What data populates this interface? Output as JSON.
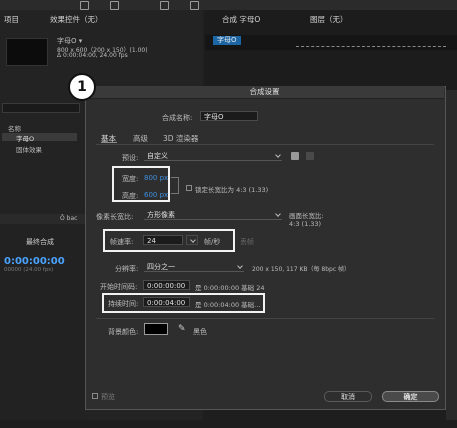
{
  "project_panel": {
    "tab_project": "项目",
    "tab_effects": "效果控件（无）",
    "item_name": "字母O ▾",
    "item_meta": [
      "800 x 600（200 x 150）(1.00)",
      "Δ 0:00:04:00, 24.00 fps"
    ],
    "column_header": "名称",
    "rows": [
      "字母O",
      "固体效果"
    ]
  },
  "comp_panel": {
    "tab_comp": "合成 字母O",
    "tab_layer": "图层（无）",
    "comp_chip": "字母O"
  },
  "timeline_panel": {
    "tab": "最终合成",
    "timecode": "0:00:00:00",
    "sub": "00000 (24.00 fps)",
    "search_chip": "Ô bac"
  },
  "dialog": {
    "title": "合成设置",
    "name_label": "合成名称:",
    "name_value": "字母O",
    "tabs": [
      "基本",
      "高级",
      "3D 渲染器"
    ],
    "preset_label": "预设:",
    "preset_value": "自定义",
    "width_label": "宽度:",
    "width_value": "800 px",
    "height_label": "高度:",
    "height_value": "600 px",
    "lock_aspect_label": "锁定长宽比为 4:3 (1.33)",
    "pixel_aspect_label": "像素长宽比:",
    "pixel_aspect_value": "方形像素",
    "frame_aspect_label": "画面长宽比:",
    "frame_aspect_value": "4:3 (1.33)",
    "frame_rate_label": "帧速率:",
    "frame_rate_value": "24",
    "frame_rate_unit": "帧/秒",
    "drop_frame": "丢帧",
    "resolution_label": "分辨率:",
    "resolution_value": "四分之一",
    "resolution_info": "200 x 150, 117 KB（每 8bpc 帧）",
    "start_tc_label": "开始时间码:",
    "start_tc_value": "0:00:00:00",
    "start_tc_info": "是 0:00:00:00 基础 24",
    "duration_label": "持续时间:",
    "duration_value": "0:00:04:00",
    "duration_info": "是 0:00:04:00 基础...",
    "bg_label": "背景颜色:",
    "bg_color_name": "黑色",
    "preview_label": "预览",
    "cancel": "取消",
    "ok": "确定"
  },
  "annotation_number": "1",
  "colors": {
    "accent_blue": "#3d8fe0",
    "chip_blue": "#1c66a6",
    "highlight": "#f2f2f2",
    "bg_swatch": "#000000"
  }
}
